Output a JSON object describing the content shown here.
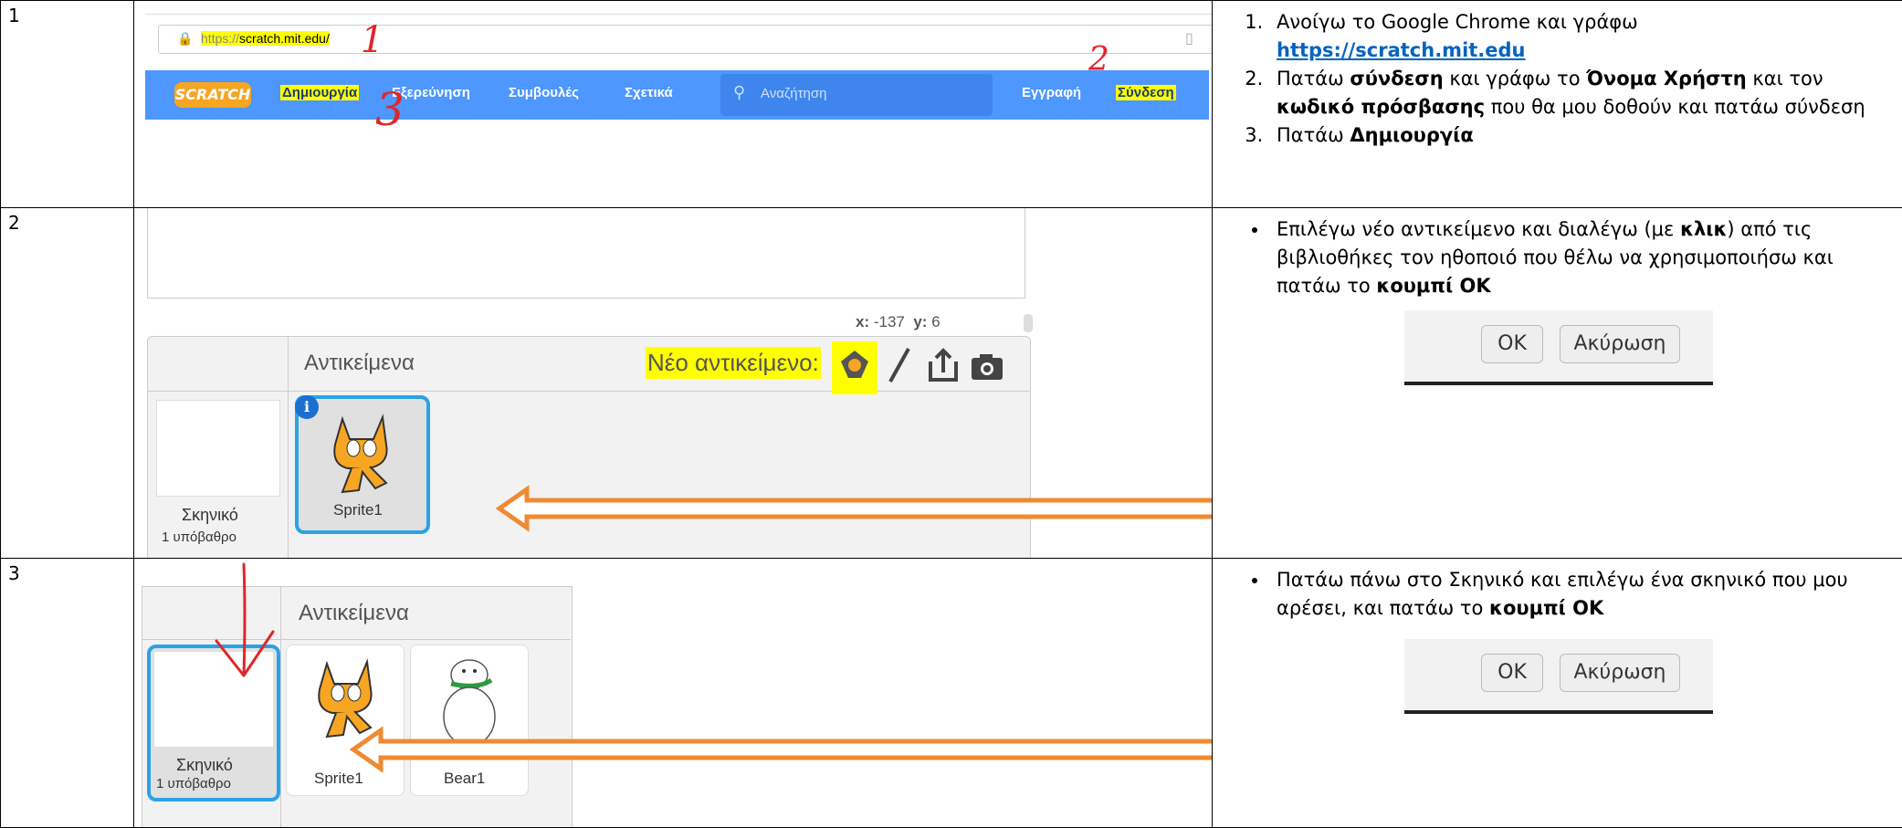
{
  "rows": [
    {
      "number": "1",
      "screenshot": {
        "url": "https://scratch.mit.edu/",
        "url_prefix": "https://",
        "url_domain": "scratch.mit.edu/",
        "logo": "SCRATCH",
        "nav": [
          "Δημιουργία",
          "Εξερεύνηση",
          "Συμβουλές",
          "Σχετικά"
        ],
        "search_placeholder": "Αναζήτηση",
        "register": "Εγγραφή",
        "login": "Σύνδεση",
        "annotations": [
          "1",
          "2",
          "3"
        ]
      },
      "steps": [
        {
          "before": "Ανοίγω το Google Chrome και  γράφω ",
          "link": "https://scratch.mit.edu"
        },
        {
          "t1": "Πατάω ",
          "b1": "σύνδεση",
          "t2": " και γράφω  το ",
          "b2": "Όνομα Χρήστη",
          "t3": " και τον ",
          "b3": "κωδικό πρόσβασης",
          "t4": "  που θα μου δοθούν και πατάω σύνδεση"
        },
        {
          "t1": "Πατάω ",
          "b1": "Δημιουργία"
        }
      ]
    },
    {
      "number": "2",
      "screenshot": {
        "coord_x_label": "x:",
        "coord_x": "-137",
        "coord_y_label": "y:",
        "coord_y": "6",
        "sprites_header": "Αντικείμενα",
        "new_sprite": "Νέο αντικείμενο:",
        "stage_label": "Σκηνικό",
        "stage_sub": "1 υπόβαθρο",
        "sprite_name": "Sprite1",
        "info_badge": "i"
      },
      "bullet": {
        "t1": "Επιλέγω νέο αντικείμενο και διαλέγω (με ",
        "b1": "κλικ",
        "t2": ") από τις βιβλιοθήκες τον ηθοποιό που θέλω να χρησιμοποιήσω και πατάω το ",
        "b2": "κουμπί ΟΚ"
      },
      "buttons": {
        "ok": "OK",
        "cancel": "Ακύρωση"
      }
    },
    {
      "number": "3",
      "screenshot": {
        "sprites_header": "Αντικείμενα",
        "stage_label": "Σκηνικό",
        "stage_sub": "1 υπόβαθρο",
        "sprite1_name": "Sprite1",
        "sprite2_name": "Bear1"
      },
      "bullet": {
        "t1": "Πατάω πάνω στο Σκηνικό και επιλέγω ένα σκηνικό που μου αρέσει, και πατάω το ",
        "b1": "κουμπί ΟΚ"
      },
      "buttons": {
        "ok": "OK",
        "cancel": "Ακύρωση"
      }
    }
  ],
  "colors": {
    "scratch_blue": "#4d97ff",
    "highlight": "#ffff00",
    "arrow": "#f4a460",
    "sprite_select": "#29a3e6"
  }
}
